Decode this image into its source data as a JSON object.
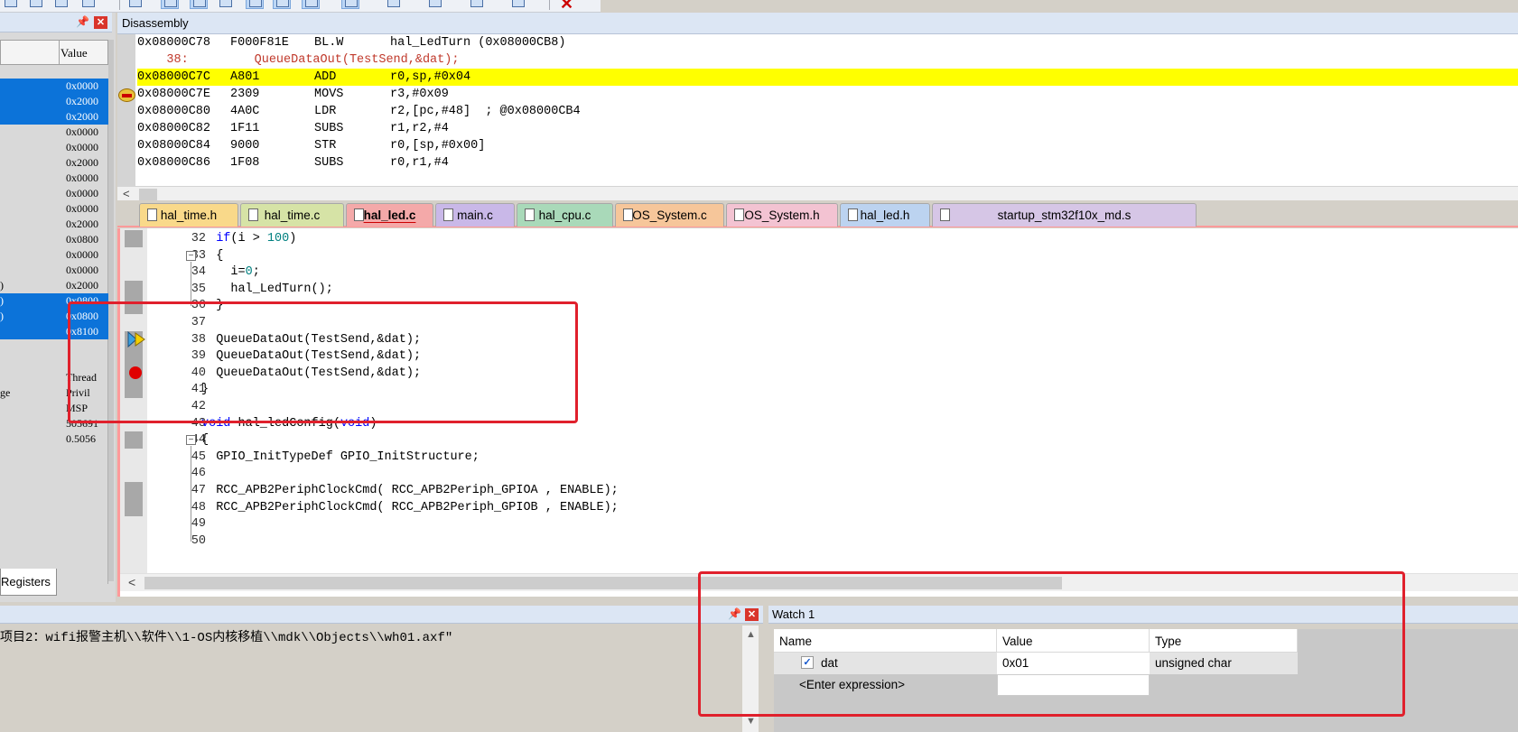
{
  "registers": {
    "column_value": "Value",
    "tab_label": "Registers",
    "rows": [
      {
        "name": "",
        "value": "0x0000",
        "selected": true
      },
      {
        "name": "",
        "value": "0x2000",
        "selected": true
      },
      {
        "name": "",
        "value": "0x2000",
        "selected": true
      },
      {
        "name": "",
        "value": "0x0000",
        "selected": false
      },
      {
        "name": "",
        "value": "0x0000",
        "selected": false
      },
      {
        "name": "",
        "value": "0x2000",
        "selected": false
      },
      {
        "name": "",
        "value": "0x0000",
        "selected": false
      },
      {
        "name": "",
        "value": "0x0000",
        "selected": false
      },
      {
        "name": "",
        "value": "0x0000",
        "selected": false
      },
      {
        "name": "",
        "value": "0x2000",
        "selected": false
      },
      {
        "name": "",
        "value": "0x0800",
        "selected": false
      },
      {
        "name": "",
        "value": "0x0000",
        "selected": false
      },
      {
        "name": "",
        "value": "0x0000",
        "selected": false
      },
      {
        "name": ")",
        "value": "0x2000",
        "selected": false
      },
      {
        "name": ")",
        "value": "0x0800",
        "selected": true
      },
      {
        "name": ")",
        "value": "0x0800",
        "selected": true
      },
      {
        "name": "",
        "value": "0x8100",
        "selected": true
      },
      {
        "name": "",
        "value": "",
        "selected": false
      },
      {
        "name": "",
        "value": "",
        "selected": false
      },
      {
        "name": "",
        "value": "Thread",
        "selected": false
      },
      {
        "name": "ge",
        "value": "Privil",
        "selected": false
      },
      {
        "name": "",
        "value": "MSP",
        "selected": false
      },
      {
        "name": "",
        "value": "505691",
        "selected": false
      },
      {
        "name": "",
        "value": "0.5056",
        "selected": false
      }
    ]
  },
  "disassembly": {
    "title": "Disassembly",
    "lines": [
      {
        "addr": "0x08000C78",
        "code": "F000F81E",
        "op": "BL.W",
        "args": "hal_LedTurn (0x08000CB8)",
        "type": "asm"
      },
      {
        "source": "    38:         QueueDataOut(TestSend,&dat);",
        "type": "src"
      },
      {
        "addr": "0x08000C7C",
        "code": "A801",
        "op": "ADD",
        "args": "r0,sp,#0x04",
        "type": "current"
      },
      {
        "addr": "0x08000C7E",
        "code": "2309",
        "op": "MOVS",
        "args": "r3,#0x09",
        "type": "asm"
      },
      {
        "addr": "0x08000C80",
        "code": "4A0C",
        "op": "LDR",
        "args": "r2,[pc,#48]  ; @0x08000CB4",
        "type": "asm"
      },
      {
        "addr": "0x08000C82",
        "code": "1F11",
        "op": "SUBS",
        "args": "r1,r2,#4",
        "type": "asm"
      },
      {
        "addr": "0x08000C84",
        "code": "9000",
        "op": "STR",
        "args": "r0,[sp,#0x00]",
        "type": "asm"
      },
      {
        "addr": "0x08000C86",
        "code": "1F08",
        "op": "SUBS",
        "args": "r0,r1,#4",
        "type": "asm"
      }
    ]
  },
  "tabs": [
    {
      "label": "hal_time.h",
      "color": "#f9d98a",
      "active": false
    },
    {
      "label": "hal_time.c",
      "color": "#d6e3a6",
      "active": false
    },
    {
      "label": "hal_led.c",
      "color": "#f4a9a9",
      "active": true
    },
    {
      "label": "main.c",
      "color": "#c9b8e8",
      "active": false
    },
    {
      "label": "hal_cpu.c",
      "color": "#a9d9b9",
      "active": false
    },
    {
      "label": "OS_System.c",
      "color": "#f6c69a",
      "active": false
    },
    {
      "label": "OS_System.h",
      "color": "#f3c3d2",
      "active": false
    },
    {
      "label": "hal_led.h",
      "color": "#bcd3f0",
      "active": false
    },
    {
      "label": "startup_stm32f10x_md.s",
      "color": "#d6c6e6",
      "active": false
    }
  ],
  "editor": {
    "lines": [
      {
        "n": "32",
        "code": "  if(i > 100)"
      },
      {
        "n": "33",
        "code": "  {"
      },
      {
        "n": "34",
        "code": "    i=0;"
      },
      {
        "n": "35",
        "code": "    hal_LedTurn();"
      },
      {
        "n": "36",
        "code": "  }"
      },
      {
        "n": "37",
        "code": ""
      },
      {
        "n": "38",
        "code": "  QueueDataOut(TestSend,&dat);"
      },
      {
        "n": "39",
        "code": "  QueueDataOut(TestSend,&dat);"
      },
      {
        "n": "40",
        "code": "  QueueDataOut(TestSend,&dat);"
      },
      {
        "n": "41",
        "code": "}"
      },
      {
        "n": "42",
        "code": ""
      },
      {
        "n": "43",
        "code": "void hal_ledConfig(void)"
      },
      {
        "n": "44",
        "code": "{"
      },
      {
        "n": "45",
        "code": "  GPIO_InitTypeDef GPIO_InitStructure;"
      },
      {
        "n": "46",
        "code": ""
      },
      {
        "n": "47",
        "code": "  RCC_APB2PeriphClockCmd( RCC_APB2Periph_GPIOA , ENABLE);"
      },
      {
        "n": "48",
        "code": "  RCC_APB2PeriphClockCmd( RCC_APB2Periph_GPIOB , ENABLE);"
      },
      {
        "n": "49",
        "code": ""
      },
      {
        "n": "50",
        "code": ""
      }
    ]
  },
  "build_output": {
    "text": "项目2：wifi报警主机\\\\软件\\\\1-OS内核移植\\\\mdk\\\\Objects\\\\wh01.axf\""
  },
  "watch": {
    "title": "Watch 1",
    "col_name": "Name",
    "col_value": "Value",
    "col_type": "Type",
    "rows": [
      {
        "name": "dat",
        "value": "0x01",
        "type": "unsigned char"
      },
      {
        "name": "<Enter expression>",
        "value": "",
        "type": ""
      }
    ]
  },
  "colors": {
    "selection": "#0c73d9",
    "current_line": "#ffff00",
    "annotation": "#e0202c"
  }
}
